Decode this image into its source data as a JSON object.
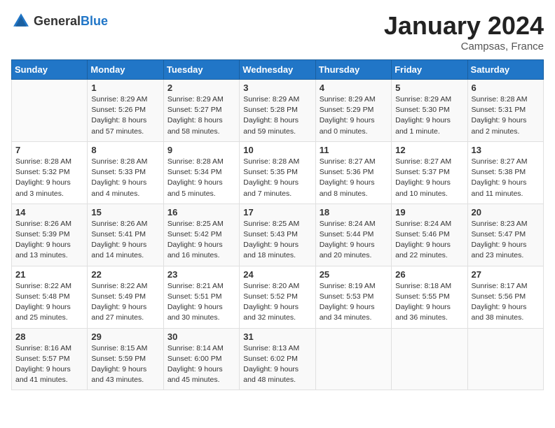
{
  "header": {
    "logo_general": "General",
    "logo_blue": "Blue",
    "month_title": "January 2024",
    "location": "Campsas, France"
  },
  "days_of_week": [
    "Sunday",
    "Monday",
    "Tuesday",
    "Wednesday",
    "Thursday",
    "Friday",
    "Saturday"
  ],
  "weeks": [
    [
      {
        "day": "",
        "info": ""
      },
      {
        "day": "1",
        "info": "Sunrise: 8:29 AM\nSunset: 5:26 PM\nDaylight: 8 hours\nand 57 minutes."
      },
      {
        "day": "2",
        "info": "Sunrise: 8:29 AM\nSunset: 5:27 PM\nDaylight: 8 hours\nand 58 minutes."
      },
      {
        "day": "3",
        "info": "Sunrise: 8:29 AM\nSunset: 5:28 PM\nDaylight: 8 hours\nand 59 minutes."
      },
      {
        "day": "4",
        "info": "Sunrise: 8:29 AM\nSunset: 5:29 PM\nDaylight: 9 hours\nand 0 minutes."
      },
      {
        "day": "5",
        "info": "Sunrise: 8:29 AM\nSunset: 5:30 PM\nDaylight: 9 hours\nand 1 minute."
      },
      {
        "day": "6",
        "info": "Sunrise: 8:28 AM\nSunset: 5:31 PM\nDaylight: 9 hours\nand 2 minutes."
      }
    ],
    [
      {
        "day": "7",
        "info": "Sunrise: 8:28 AM\nSunset: 5:32 PM\nDaylight: 9 hours\nand 3 minutes."
      },
      {
        "day": "8",
        "info": "Sunrise: 8:28 AM\nSunset: 5:33 PM\nDaylight: 9 hours\nand 4 minutes."
      },
      {
        "day": "9",
        "info": "Sunrise: 8:28 AM\nSunset: 5:34 PM\nDaylight: 9 hours\nand 5 minutes."
      },
      {
        "day": "10",
        "info": "Sunrise: 8:28 AM\nSunset: 5:35 PM\nDaylight: 9 hours\nand 7 minutes."
      },
      {
        "day": "11",
        "info": "Sunrise: 8:27 AM\nSunset: 5:36 PM\nDaylight: 9 hours\nand 8 minutes."
      },
      {
        "day": "12",
        "info": "Sunrise: 8:27 AM\nSunset: 5:37 PM\nDaylight: 9 hours\nand 10 minutes."
      },
      {
        "day": "13",
        "info": "Sunrise: 8:27 AM\nSunset: 5:38 PM\nDaylight: 9 hours\nand 11 minutes."
      }
    ],
    [
      {
        "day": "14",
        "info": "Sunrise: 8:26 AM\nSunset: 5:39 PM\nDaylight: 9 hours\nand 13 minutes."
      },
      {
        "day": "15",
        "info": "Sunrise: 8:26 AM\nSunset: 5:41 PM\nDaylight: 9 hours\nand 14 minutes."
      },
      {
        "day": "16",
        "info": "Sunrise: 8:25 AM\nSunset: 5:42 PM\nDaylight: 9 hours\nand 16 minutes."
      },
      {
        "day": "17",
        "info": "Sunrise: 8:25 AM\nSunset: 5:43 PM\nDaylight: 9 hours\nand 18 minutes."
      },
      {
        "day": "18",
        "info": "Sunrise: 8:24 AM\nSunset: 5:44 PM\nDaylight: 9 hours\nand 20 minutes."
      },
      {
        "day": "19",
        "info": "Sunrise: 8:24 AM\nSunset: 5:46 PM\nDaylight: 9 hours\nand 22 minutes."
      },
      {
        "day": "20",
        "info": "Sunrise: 8:23 AM\nSunset: 5:47 PM\nDaylight: 9 hours\nand 23 minutes."
      }
    ],
    [
      {
        "day": "21",
        "info": "Sunrise: 8:22 AM\nSunset: 5:48 PM\nDaylight: 9 hours\nand 25 minutes."
      },
      {
        "day": "22",
        "info": "Sunrise: 8:22 AM\nSunset: 5:49 PM\nDaylight: 9 hours\nand 27 minutes."
      },
      {
        "day": "23",
        "info": "Sunrise: 8:21 AM\nSunset: 5:51 PM\nDaylight: 9 hours\nand 30 minutes."
      },
      {
        "day": "24",
        "info": "Sunrise: 8:20 AM\nSunset: 5:52 PM\nDaylight: 9 hours\nand 32 minutes."
      },
      {
        "day": "25",
        "info": "Sunrise: 8:19 AM\nSunset: 5:53 PM\nDaylight: 9 hours\nand 34 minutes."
      },
      {
        "day": "26",
        "info": "Sunrise: 8:18 AM\nSunset: 5:55 PM\nDaylight: 9 hours\nand 36 minutes."
      },
      {
        "day": "27",
        "info": "Sunrise: 8:17 AM\nSunset: 5:56 PM\nDaylight: 9 hours\nand 38 minutes."
      }
    ],
    [
      {
        "day": "28",
        "info": "Sunrise: 8:16 AM\nSunset: 5:57 PM\nDaylight: 9 hours\nand 41 minutes."
      },
      {
        "day": "29",
        "info": "Sunrise: 8:15 AM\nSunset: 5:59 PM\nDaylight: 9 hours\nand 43 minutes."
      },
      {
        "day": "30",
        "info": "Sunrise: 8:14 AM\nSunset: 6:00 PM\nDaylight: 9 hours\nand 45 minutes."
      },
      {
        "day": "31",
        "info": "Sunrise: 8:13 AM\nSunset: 6:02 PM\nDaylight: 9 hours\nand 48 minutes."
      },
      {
        "day": "",
        "info": ""
      },
      {
        "day": "",
        "info": ""
      },
      {
        "day": "",
        "info": ""
      }
    ]
  ]
}
